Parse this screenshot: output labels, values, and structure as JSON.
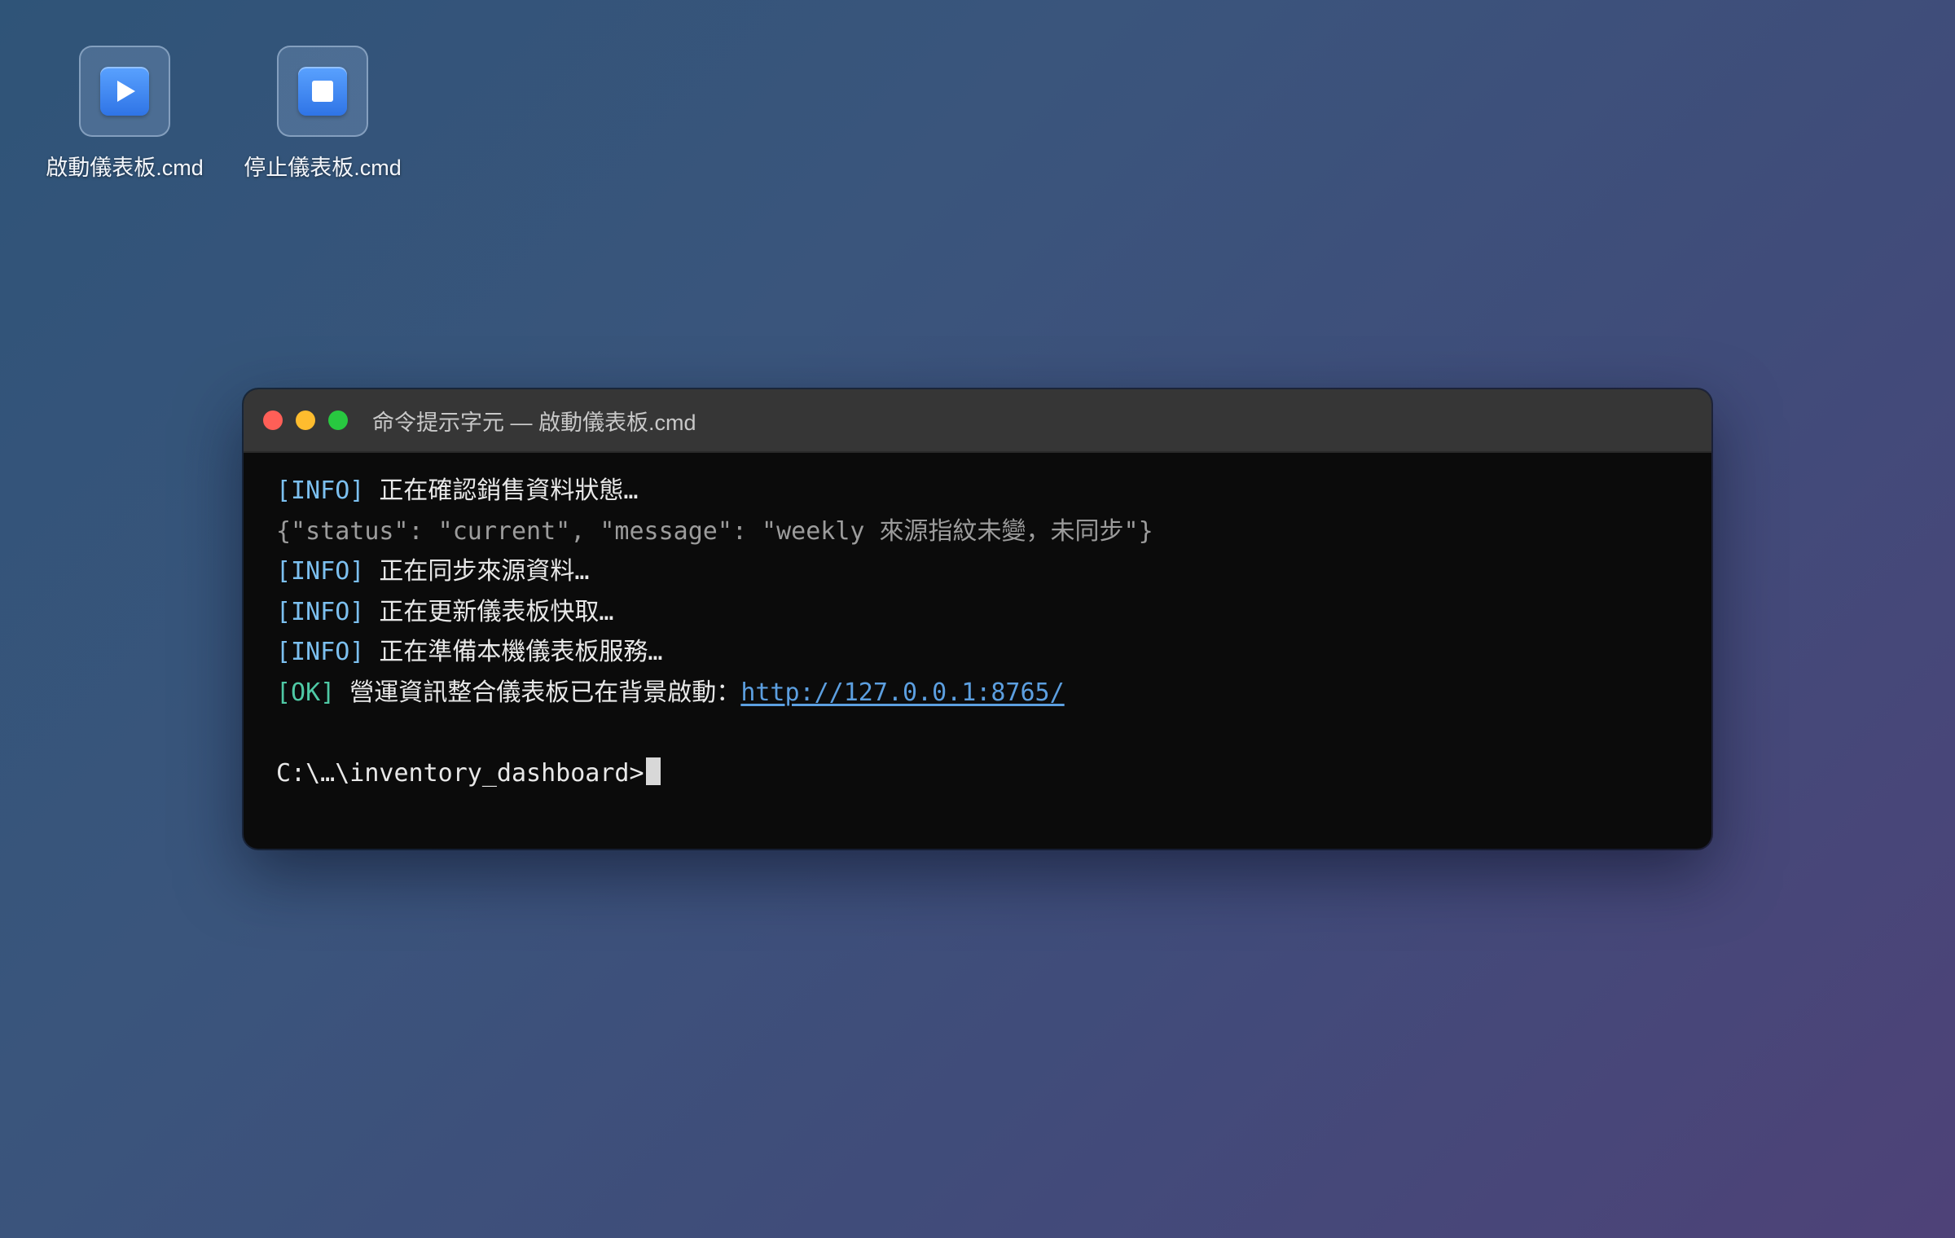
{
  "desktop": {
    "icons": [
      {
        "label": "啟動儀表板.cmd",
        "glyph": "play-icon"
      },
      {
        "label": "停止儀表板.cmd",
        "glyph": "stop-icon"
      }
    ]
  },
  "terminal": {
    "title": "命令提示字元 — 啟動儀表板.cmd",
    "lines": [
      {
        "tag": "[INFO]",
        "text": " 正在確認銷售資料狀態…"
      },
      {
        "text": "{\"status\": \"current\", \"message\": \"weekly 來源指紋未變，未同步\"}"
      },
      {
        "tag": "[INFO]",
        "text": " 正在同步來源資料…"
      },
      {
        "tag": "[INFO]",
        "text": " 正在更新儀表板快取…"
      },
      {
        "tag": "[INFO]",
        "text": " 正在準備本機儀表板服務…"
      },
      {
        "tag": "[OK]",
        "text": " 營運資訊整合儀表板已在背景啟動：",
        "link": "http://127.0.0.1:8765/"
      }
    ],
    "prompt": "C:\\…\\inventory_dashboard>"
  },
  "colors": {
    "info_tag": "#7cc0f0",
    "ok_tag": "#4fc9a5",
    "link": "#5c9fe0",
    "close": "#ff5f57",
    "minimize": "#febc2e",
    "zoom": "#28c840"
  }
}
